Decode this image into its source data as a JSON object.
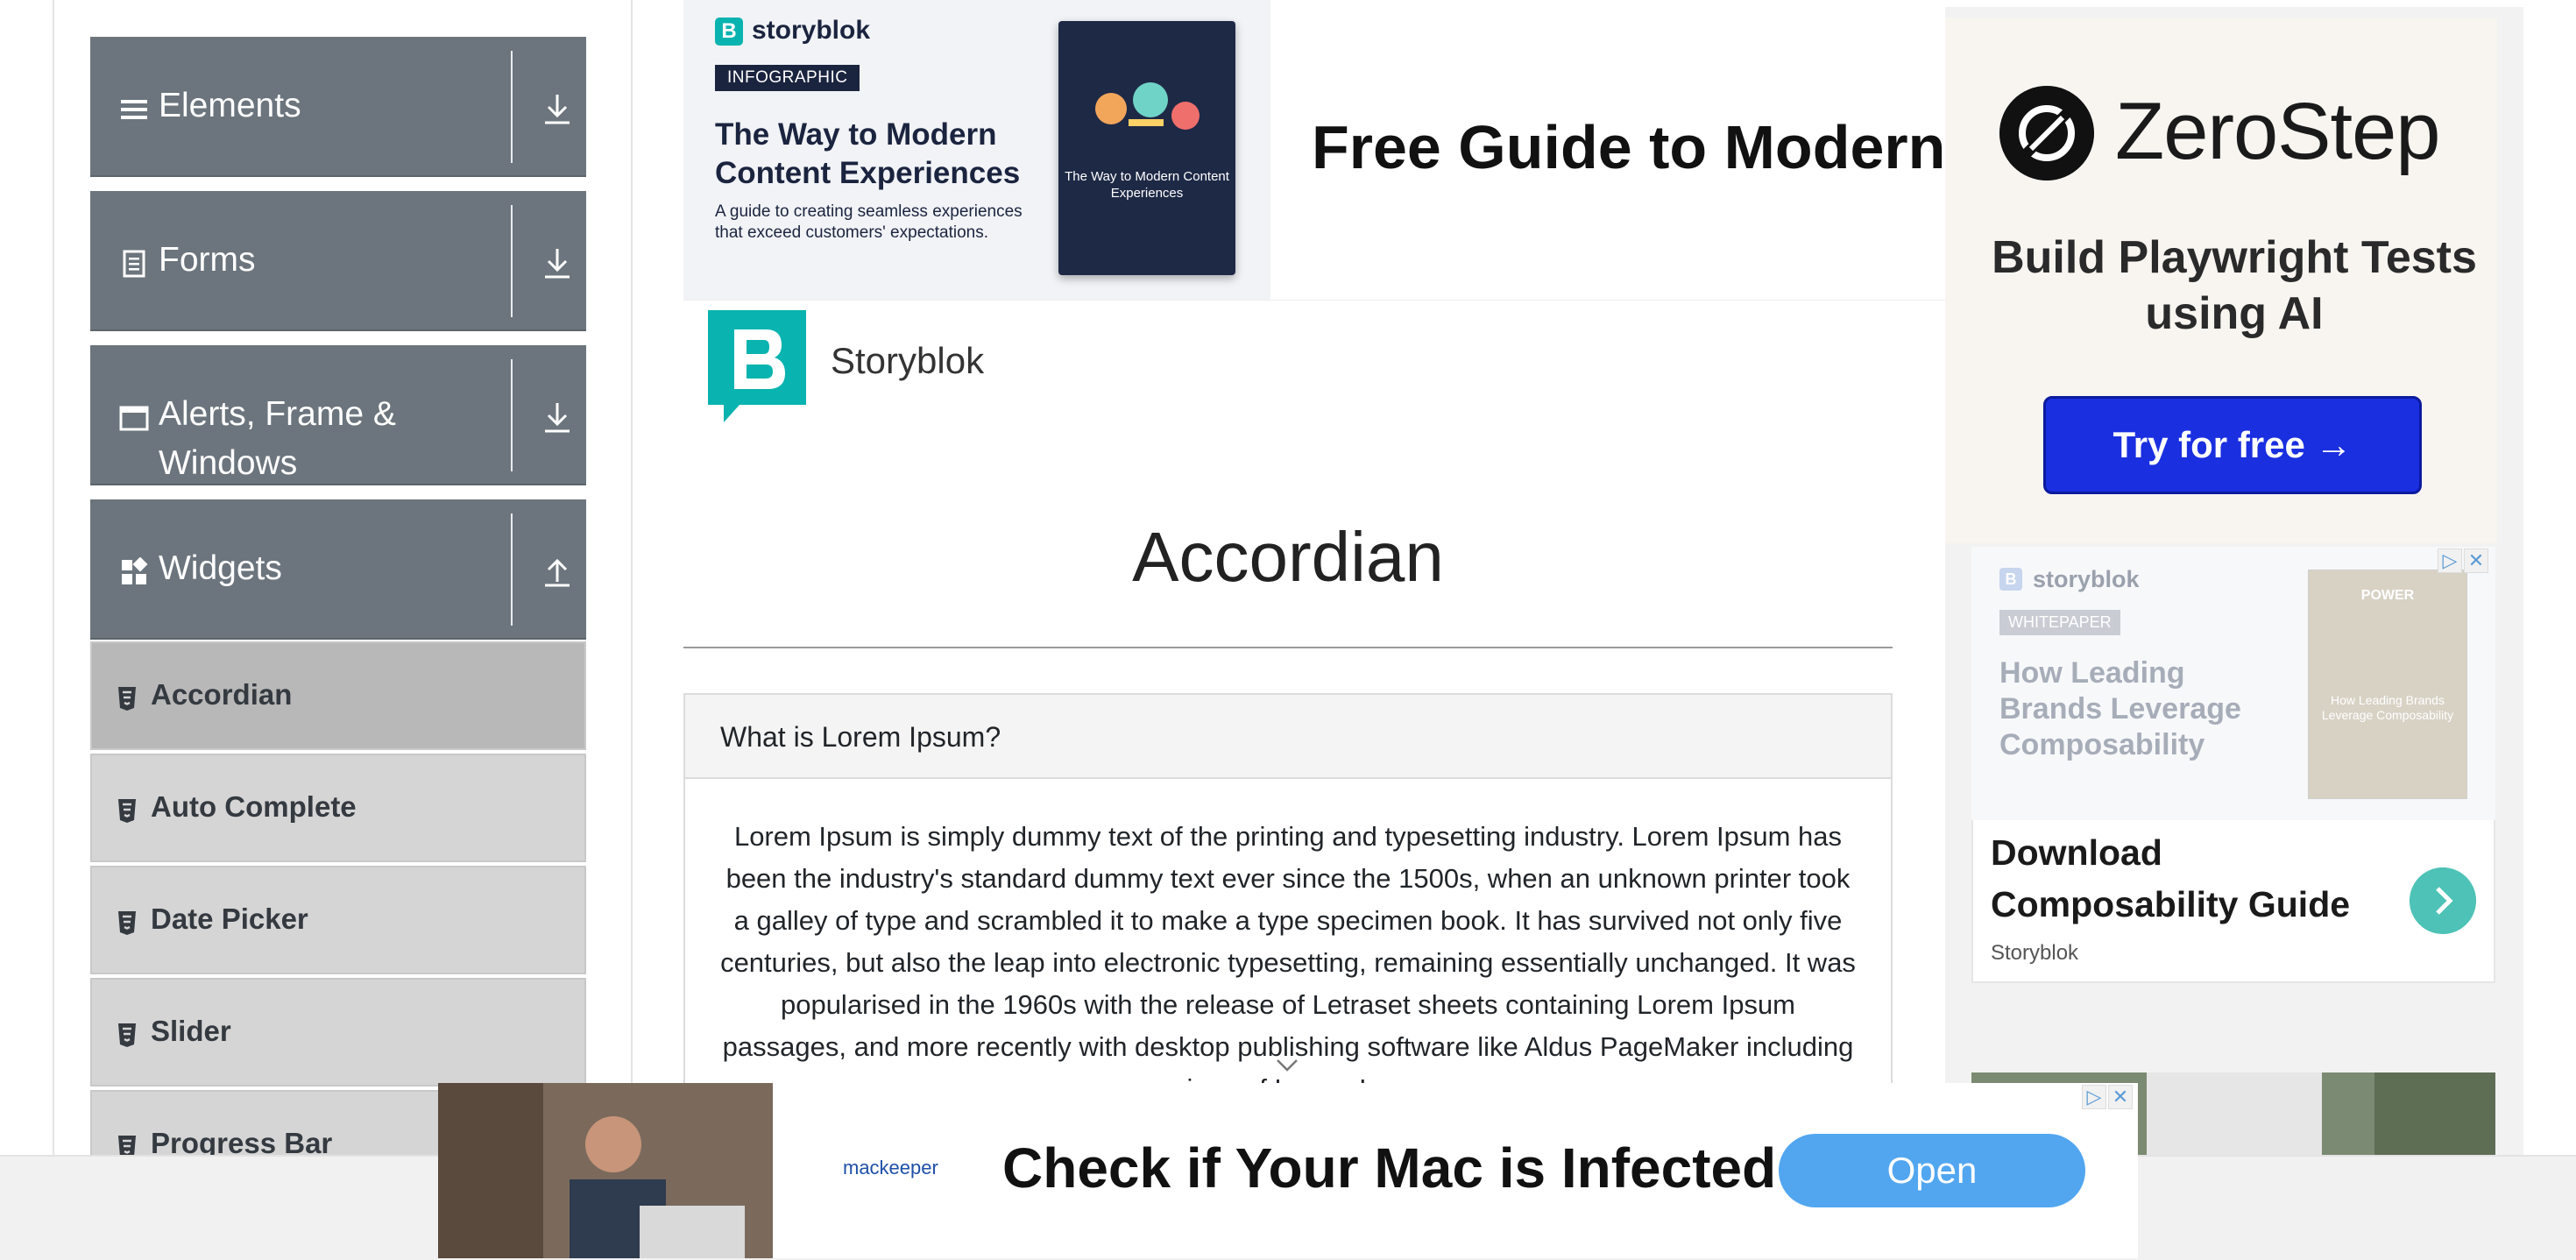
{
  "sidebar": {
    "groups": [
      {
        "label": "Elements",
        "icon": "hamburger-icon",
        "arrow": "download-arrow-icon"
      },
      {
        "label": "Forms",
        "icon": "form-icon",
        "arrow": "download-arrow-icon"
      },
      {
        "label": "Alerts, Frame &",
        "label2": "Windows",
        "icon": "window-icon",
        "arrow": "download-arrow-icon"
      },
      {
        "label": "Widgets",
        "icon": "widgets-icon",
        "arrow": "upload-arrow-icon"
      }
    ],
    "items": [
      {
        "label": "Accordian",
        "active": true
      },
      {
        "label": "Auto Complete"
      },
      {
        "label": "Date Picker"
      },
      {
        "label": "Slider"
      },
      {
        "label": "Progress Bar"
      }
    ]
  },
  "top_ad": {
    "brand": "storyblok",
    "tag": "INFOGRAPHIC",
    "title": "The Way to Modern Content Experiences",
    "subtitle": "A guide to creating seamless experiences that exceed customers' expectations.",
    "book_title": "The Way to Modern Content Experiences",
    "headline": "Free Guide to Modern Content Experiences",
    "logo_name": "Storyblok"
  },
  "main": {
    "page_title": "Accordian",
    "accordion_question": "What is Lorem Ipsum?",
    "accordion_text": "Lorem Ipsum is simply dummy text of the printing and typesetting industry. Lorem Ipsum has been the industry's standard dummy text ever since the 1500s, when an unknown printer took a galley of type and scrambled it to make a type specimen book. It has survived not only five centuries, but also the leap into electronic typesetting, remaining essentially unchanged. It was popularised in the 1960s with the release of Letraset sheets containing Lorem Ipsum passages, and more recently with desktop publishing software like Aldus PageMaker including versions of Lorem Ipsum."
  },
  "right_ad": {
    "zs_name": "ZeroStep",
    "zs_tagline": "Build Playwright Tests using AI",
    "zs_button": "Try for free →",
    "sb_brand": "storyblok",
    "sb_tag": "WHITEPAPER",
    "sb_title": "How Leading Brands Leverage Composability",
    "sb_book_title": "How Leading Brands Leverage Composability",
    "sb_book_top": "POWER",
    "download_title": "Download Composability Guide",
    "download_source": "Storyblok",
    "ad_close": "✕",
    "ad_info": "▷"
  },
  "bottom_ad": {
    "brand": "mackeeper",
    "text": "Check if Your Mac is Infected",
    "button": "Open"
  },
  "colors": {
    "sidebar_group": "#6c757d",
    "sidebar_item": "#d5d5d5",
    "storyblok_teal": "#09b3af",
    "zerostep_button": "#1a2fe0",
    "mackeeper_button": "#52a6f0"
  }
}
